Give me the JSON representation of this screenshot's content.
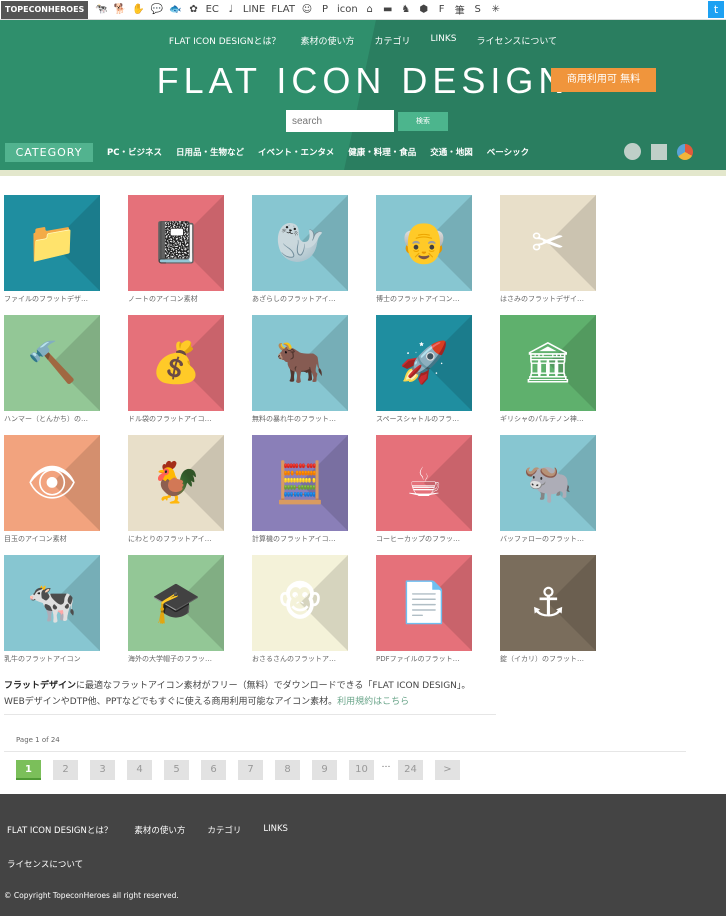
{
  "topbar": {
    "brand": "TOPECONHEROES",
    "sites": [
      "🐄",
      "🐕",
      "✋",
      "💬",
      "🐟",
      "✿",
      "EC",
      "♩",
      "LINE",
      "FLAT",
      "☺",
      "P",
      "icon",
      "⌂",
      "▬",
      "♞",
      "⬢",
      "F",
      "筆",
      "S",
      "▦",
      "✳"
    ]
  },
  "header": {
    "nav": [
      "FLAT ICON DESIGNとは？",
      "素材の使い方",
      "カテゴリ",
      "LINKS",
      "ライセンスについて"
    ],
    "title": "FLAT ICON DESIGN",
    "badge": "商用利用可 無料",
    "search_placeholder": "search",
    "search_button": "検索",
    "category_label": "CATEGORY",
    "categories": [
      "PC・ビジネス",
      "日用品・生物など",
      "イベント・エンタメ",
      "健康・料理・食品",
      "交通・地図",
      "ベーシック"
    ]
  },
  "icons": [
    {
      "caption": "ファイルのフラットデザ…",
      "bg": "#1f8ea0",
      "glyph": "📁"
    },
    {
      "caption": "ノートのアイコン素材",
      "bg": "#e5717a",
      "glyph": "📓"
    },
    {
      "caption": "あざらしのフラットアイ…",
      "bg": "#87c6d1",
      "glyph": "🦭"
    },
    {
      "caption": "博士のフラットアイコン…",
      "bg": "#87c6d1",
      "glyph": "👴"
    },
    {
      "caption": "はさみのフラットデザイ…",
      "bg": "#e8dfc9",
      "glyph": "✂"
    },
    {
      "caption": "ハンマー（とんかち）の…",
      "bg": "#93c796",
      "glyph": "🔨"
    },
    {
      "caption": "ドル袋のフラットアイコ…",
      "bg": "#e5717a",
      "glyph": "💰"
    },
    {
      "caption": "無料の暴れ牛のフラット…",
      "bg": "#87c6d1",
      "glyph": "🐂"
    },
    {
      "caption": "スペースシャトルのフラ…",
      "bg": "#1f8ea0",
      "glyph": "🚀"
    },
    {
      "caption": "ギリシャのパルテノン神…",
      "bg": "#5fb06d",
      "glyph": "🏛"
    },
    {
      "caption": "目玉のアイコン素材",
      "bg": "#f2a37e",
      "glyph": "👁"
    },
    {
      "caption": "にわとりのフラットアイ…",
      "bg": "#e8dfc9",
      "glyph": "🐓"
    },
    {
      "caption": "計算機のフラットアイコ…",
      "bg": "#8a7fb8",
      "glyph": "🧮"
    },
    {
      "caption": "コーヒーカップのフラッ…",
      "bg": "#e5717a",
      "glyph": "☕"
    },
    {
      "caption": "バッファローのフラット…",
      "bg": "#87c6d1",
      "glyph": "🐃"
    },
    {
      "caption": "乳牛のフラットアイコン",
      "bg": "#87c6d1",
      "glyph": "🐄"
    },
    {
      "caption": "海外の大学帽子のフラッ…",
      "bg": "#93c796",
      "glyph": "🎓"
    },
    {
      "caption": "おさるさんのフラットア…",
      "bg": "#f4f2d9",
      "glyph": "🐵"
    },
    {
      "caption": "PDFファイルのフラット…",
      "bg": "#e5717a",
      "glyph": "📄"
    },
    {
      "caption": "錠（イカリ）のフラット…",
      "bg": "#7a6d5c",
      "glyph": "⚓"
    }
  ],
  "description": {
    "bold": "フラットデザイン",
    "text1": "に最適なフラットアイコン素材がフリー（無料）でダウンロードできる「FLAT ICON DESIGN」。",
    "text2": "WEBデザインやDTP他、PPTなどでもすぐに使える商用利用可能なアイコン素材。",
    "link": "利用規約はこちら"
  },
  "pagination": {
    "info": "Page 1 of 24",
    "pages": [
      "1",
      "2",
      "3",
      "4",
      "5",
      "6",
      "7",
      "8",
      "9",
      "10"
    ],
    "dots": "…",
    "last": "24",
    "next": ">"
  },
  "footer": {
    "links": [
      "FLAT ICON DESIGNとは？",
      "素材の使い方",
      "カテゴリ",
      "LINKS"
    ],
    "links2": "ライセンスについて",
    "copyright": "© Copyright TopeconHeroes all right reserved."
  }
}
